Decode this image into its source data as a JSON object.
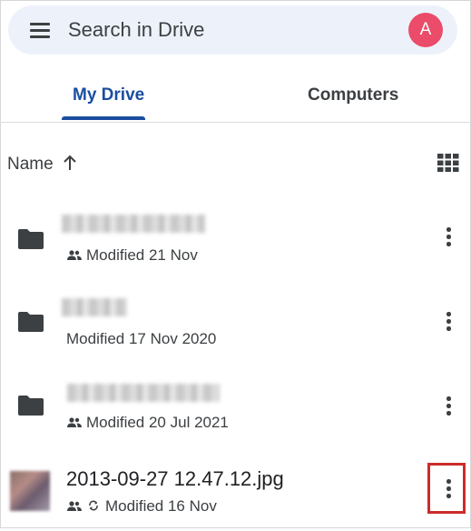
{
  "search": {
    "placeholder": "Search in Drive",
    "avatar_letter": "A",
    "avatar_color": "#ea4c6a"
  },
  "tabs": [
    {
      "label": "My Drive",
      "active": true
    },
    {
      "label": "Computers",
      "active": false
    }
  ],
  "sort": {
    "label": "Name",
    "direction": "ascending"
  },
  "files": [
    {
      "type": "folder",
      "name_blurred": true,
      "shared": true,
      "modified": "Modified 21 Nov"
    },
    {
      "type": "folder",
      "name_blurred": true,
      "shared": false,
      "modified": "Modified 17 Nov 2020"
    },
    {
      "type": "folder",
      "name_blurred": true,
      "shared": true,
      "modified": "Modified 20 Jul 2021"
    },
    {
      "type": "image",
      "name": "2013-09-27 12.47.12.jpg",
      "shared": true,
      "synced": true,
      "modified": "Modified 16 Nov",
      "more_highlighted": true
    }
  ],
  "colors": {
    "accent": "#1a4ea0",
    "highlight": "#cc2b2b",
    "search_bg": "#edf2fa"
  }
}
